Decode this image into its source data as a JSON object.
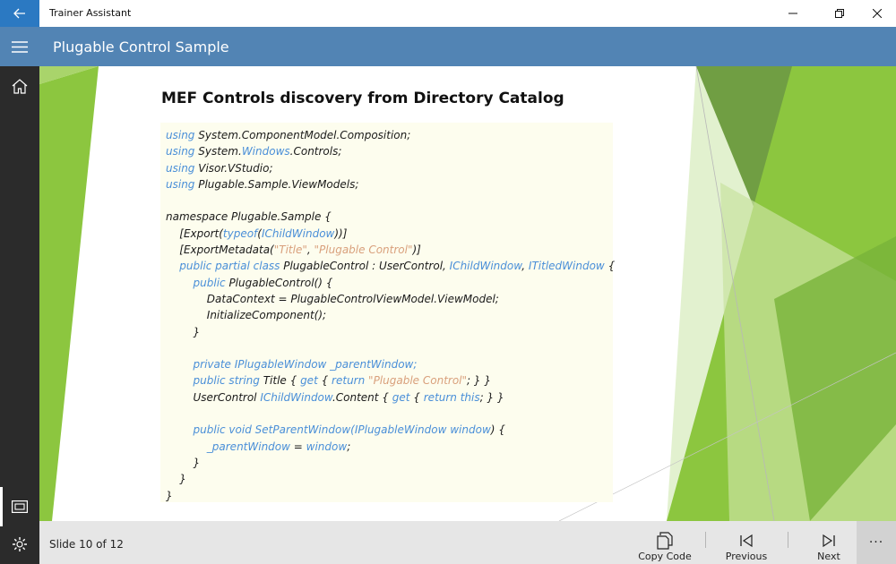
{
  "window": {
    "app_title": "Trainer Assistant",
    "back_icon": "arrow-left-icon",
    "minimize_icon": "minimize-icon",
    "restore_icon": "restore-icon",
    "close_icon": "close-icon"
  },
  "header": {
    "menu_icon": "hamburger-icon",
    "page_title": "Plugable Control Sample"
  },
  "sidebar": {
    "home_icon": "home-icon",
    "slides_icon": "presentation-icon",
    "settings_icon": "gear-icon"
  },
  "slide": {
    "heading": "MEF Controls discovery from Directory Catalog",
    "code_lines": [
      [
        {
          "t": "using",
          "c": "kw"
        },
        {
          "t": " System.ComponentModel.Composition;"
        }
      ],
      [
        {
          "t": "using",
          "c": "kw"
        },
        {
          "t": " System."
        },
        {
          "t": "Windows",
          "c": "ty"
        },
        {
          "t": ".Controls;"
        }
      ],
      [
        {
          "t": "using",
          "c": "kw"
        },
        {
          "t": " Visor.VStudio;"
        }
      ],
      [
        {
          "t": "using",
          "c": "kw"
        },
        {
          "t": " Plugable.Sample.ViewModels;"
        }
      ],
      [
        {
          "t": ""
        }
      ],
      [
        {
          "t": "namespace Plugable.Sample {"
        }
      ],
      [
        {
          "t": "    [Export("
        },
        {
          "t": "typeof",
          "c": "kw"
        },
        {
          "t": "("
        },
        {
          "t": "IChildWindow",
          "c": "ty"
        },
        {
          "t": "))]"
        }
      ],
      [
        {
          "t": "    [ExportMetadata("
        },
        {
          "t": "\"Title\"",
          "c": "str"
        },
        {
          "t": ", "
        },
        {
          "t": "\"Plugable Control\"",
          "c": "str"
        },
        {
          "t": ")]"
        }
      ],
      [
        {
          "t": "    "
        },
        {
          "t": "public partial class",
          "c": "kw"
        },
        {
          "t": " PlugableControl : UserControl, "
        },
        {
          "t": "IChildWindow",
          "c": "ty"
        },
        {
          "t": ", "
        },
        {
          "t": "ITitledWindow",
          "c": "ty"
        },
        {
          "t": " {"
        }
      ],
      [
        {
          "t": "        "
        },
        {
          "t": "public",
          "c": "kw"
        },
        {
          "t": " PlugableControl() {"
        }
      ],
      [
        {
          "t": "            DataContext = PlugableControlViewModel.ViewModel;"
        }
      ],
      [
        {
          "t": "            InitializeComponent();"
        }
      ],
      [
        {
          "t": "        }"
        }
      ],
      [
        {
          "t": ""
        }
      ],
      [
        {
          "t": "        "
        },
        {
          "t": "private IPlugableWindow _parentWindow;",
          "c": "kw"
        }
      ],
      [
        {
          "t": "        "
        },
        {
          "t": "public string",
          "c": "kw"
        },
        {
          "t": " Title { "
        },
        {
          "t": "get",
          "c": "kw"
        },
        {
          "t": " { "
        },
        {
          "t": "return",
          "c": "kw"
        },
        {
          "t": " "
        },
        {
          "t": "\"Plugable Control\"",
          "c": "str"
        },
        {
          "t": "; } }"
        }
      ],
      [
        {
          "t": "        UserControl "
        },
        {
          "t": "IChildWindow",
          "c": "ty"
        },
        {
          "t": ".Content { "
        },
        {
          "t": "get",
          "c": "kw"
        },
        {
          "t": " { "
        },
        {
          "t": "return this",
          "c": "kw"
        },
        {
          "t": "; } }"
        }
      ],
      [
        {
          "t": ""
        }
      ],
      [
        {
          "t": "        "
        },
        {
          "t": "public void SetParentWindow(",
          "c": "kw"
        },
        {
          "t": "IPlugableWindow window",
          "c": "kw"
        },
        {
          "t": ") {"
        }
      ],
      [
        {
          "t": "            "
        },
        {
          "t": "_parentWindow",
          "c": "kw"
        },
        {
          "t": " = "
        },
        {
          "t": "window",
          "c": "kw"
        },
        {
          "t": ";"
        }
      ],
      [
        {
          "t": "        }"
        }
      ],
      [
        {
          "t": "    }"
        }
      ],
      [
        {
          "t": "}"
        }
      ]
    ]
  },
  "status": {
    "slide_info": "Slide 10 of 12"
  },
  "commands": {
    "copy_label": "Copy Code",
    "copy_icon": "copy-icon",
    "previous_label": "Previous",
    "previous_icon": "skip-back-icon",
    "next_label": "Next",
    "next_icon": "skip-forward-icon",
    "more_icon": "more-icon",
    "more_glyph": "···"
  },
  "colors": {
    "titlebar_back": "#2b79c2",
    "header": "#5284b4",
    "sidebar": "#2b2b2b",
    "code_bg": "#fdfdee",
    "keyword": "#4a8fd8",
    "string": "#d9a07c",
    "accent_green": "#8cc63f"
  }
}
